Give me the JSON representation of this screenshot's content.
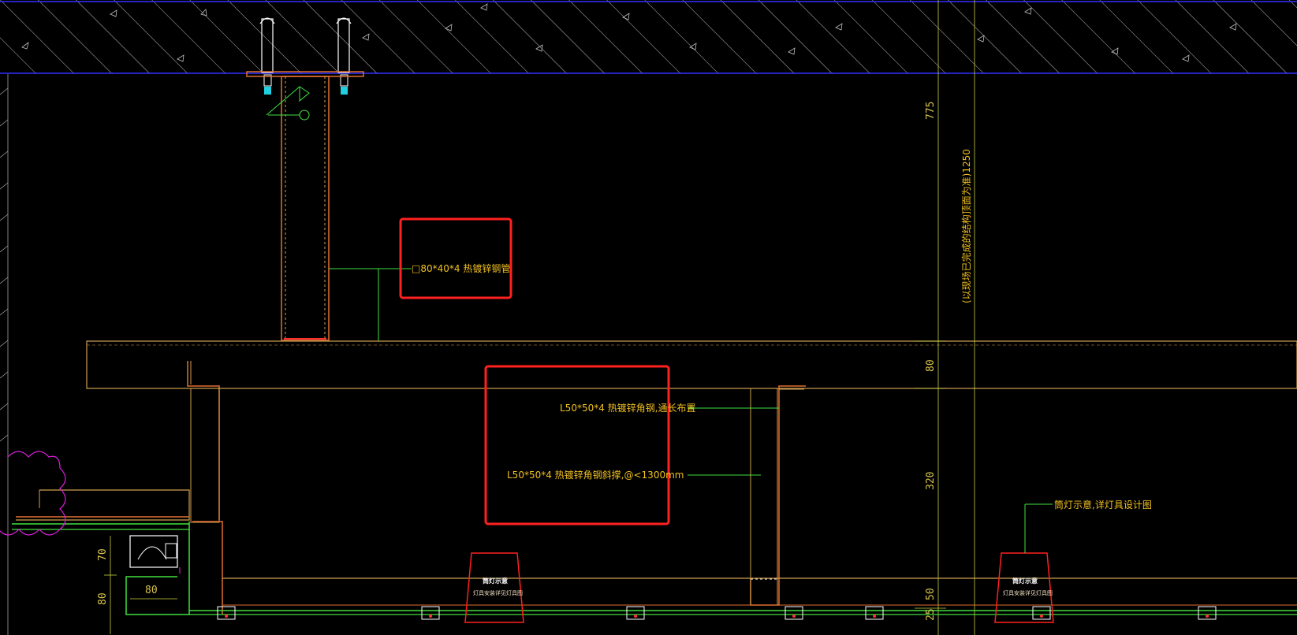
{
  "annotations": {
    "steel_pipe": "□80*40*4 热镀锌钢管",
    "angle_long": "L50*50*4 热镀锌角钢,通长布置",
    "angle_brace": "L50*50*4 热镀锌角钢斜撑,@<1300mm",
    "lamp_note": "筒灯示意,详灯具设计图",
    "vertical_note": "(以现场已完成的结构顶面为准)1250",
    "light_label_1": "筒灯示意",
    "light_label_2": "筒灯示意",
    "light_sub_1": "灯具安装详见灯具图",
    "light_sub_2": "灯具安装详见灯具图"
  },
  "dimensions": {
    "d775": "775",
    "d80_top": "80",
    "d320": "320",
    "d50": "50",
    "d25": "25",
    "d70": "70",
    "d80_left": "80",
    "d80_box": "80"
  },
  "highlights": {
    "box_color": "#ff2020"
  },
  "colors": {
    "beam": "#d0a050",
    "steel": "#e07030",
    "green": "#40e040",
    "dim_line": "#c8d040",
    "structure": "#3030ff",
    "hatch": "#c0c0c0"
  }
}
